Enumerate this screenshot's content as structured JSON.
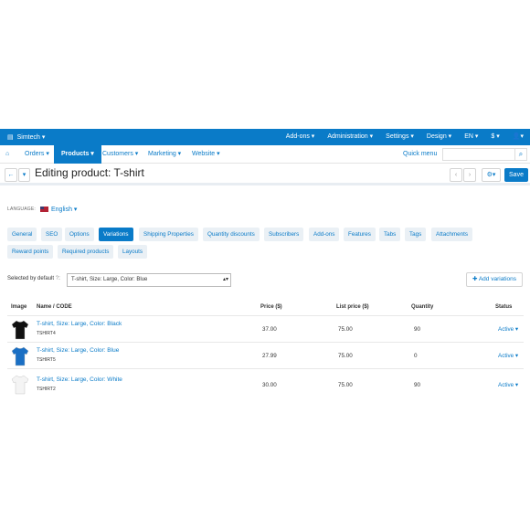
{
  "topbar": {
    "brand": "Simtech",
    "menu": [
      "Add-ons",
      "Administration",
      "Settings",
      "Design",
      "EN",
      "$"
    ]
  },
  "nav": {
    "items": [
      "Orders",
      "Products",
      "Customers",
      "Marketing",
      "Website"
    ],
    "quick_menu": "Quick menu"
  },
  "toolbar": {
    "title": "Editing product: T-shirt",
    "save": "Save"
  },
  "language": {
    "label": "LANGUAGE:",
    "value": "English"
  },
  "tabs": [
    "General",
    "SEO",
    "Options",
    "Variations",
    "Shipping Properties",
    "Quantity discounts",
    "Subscribers",
    "Add-ons",
    "Features",
    "Tabs",
    "Tags",
    "Attachments",
    "Reward points",
    "Required products",
    "Layouts"
  ],
  "active_tab": "Variations",
  "selected_default": {
    "label": "Selected by default",
    "value": "T-shirt, Size: Large, Color: Blue"
  },
  "add_variations": "Add variations",
  "table": {
    "headers": {
      "image": "Image",
      "name": "Name / CODE",
      "price": "Price ($)",
      "list": "List price ($)",
      "qty": "Quantity",
      "status": "Status"
    },
    "rows": [
      {
        "name": "T-shirt, Size: Large, Color: Black",
        "code": "TSHIRT4",
        "price": "37.00",
        "list": "75.00",
        "qty": "90",
        "status": "Active",
        "color": "#111111"
      },
      {
        "name": "T-shirt, Size: Large, Color: Blue",
        "code": "TSHIRT5",
        "price": "27.99",
        "list": "75.00",
        "qty": "0",
        "status": "Active",
        "color": "#1a6fc4"
      },
      {
        "name": "T-shirt, Size: Large, Color: White",
        "code": "TSHIRT2",
        "price": "30.00",
        "list": "75.00",
        "qty": "90",
        "status": "Active",
        "color": "#f4f4f4"
      }
    ]
  }
}
